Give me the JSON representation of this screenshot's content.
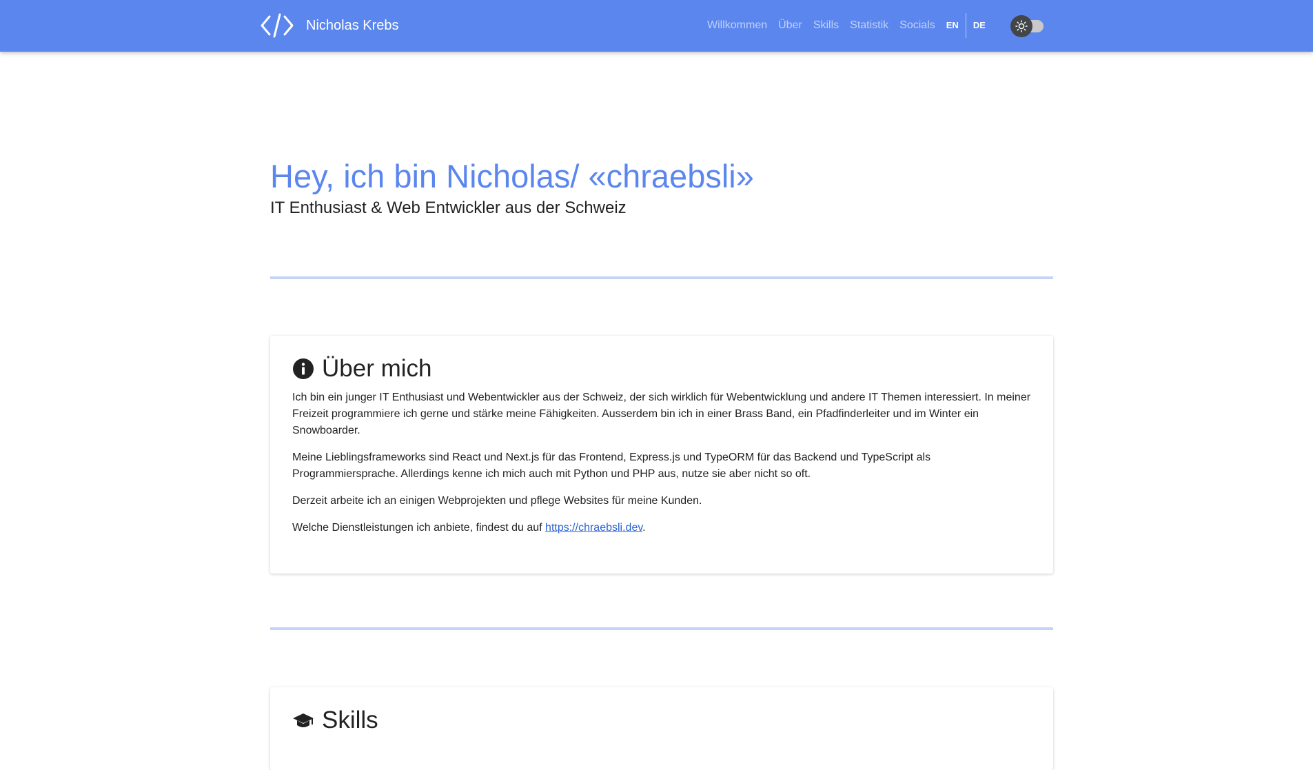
{
  "navbar": {
    "brand_name": "Nicholas Krebs",
    "links": [
      "Willkommen",
      "Über",
      "Skills",
      "Statistik",
      "Socials"
    ],
    "languages": [
      "EN",
      "DE"
    ],
    "theme_toggle_state": "light"
  },
  "hero": {
    "title": "Hey, ich bin Nicholas/ «chraebsli»",
    "subtitle": "IT Enthusiast & Web Entwickler aus der Schweiz"
  },
  "about": {
    "title": "Über mich",
    "paragraphs": [
      "Ich bin ein junger IT Enthusiast und Webentwickler aus der Schweiz, der sich wirklich für Webentwicklung und andere IT Themen interessiert. In meiner Freizeit programmiere ich gerne und stärke meine Fähigkeiten. Ausserdem bin ich in einer Brass Band, ein Pfadfinderleiter und im Winter ein Snowboarder.",
      "Meine Lieblingsframeworks sind React und Next.js für das Frontend, Express.js und TypeORM für das Backend und TypeScript als Programmiersprache. Allerdings kenne ich mich auch mit Python und PHP aus, nutze sie aber nicht so oft.",
      "Derzeit arbeite ich an einigen Webprojekten und pflege Websites für meine Kunden."
    ],
    "services_prefix": "Welche Dienstleistungen ich anbiete, findest du auf ",
    "services_link": "https://chraebsli.dev",
    "services_suffix": "."
  },
  "skills": {
    "title": "Skills"
  },
  "colors": {
    "accent": "#5b86ee",
    "divider": "#c5d3f7",
    "link": "#2962d6"
  }
}
